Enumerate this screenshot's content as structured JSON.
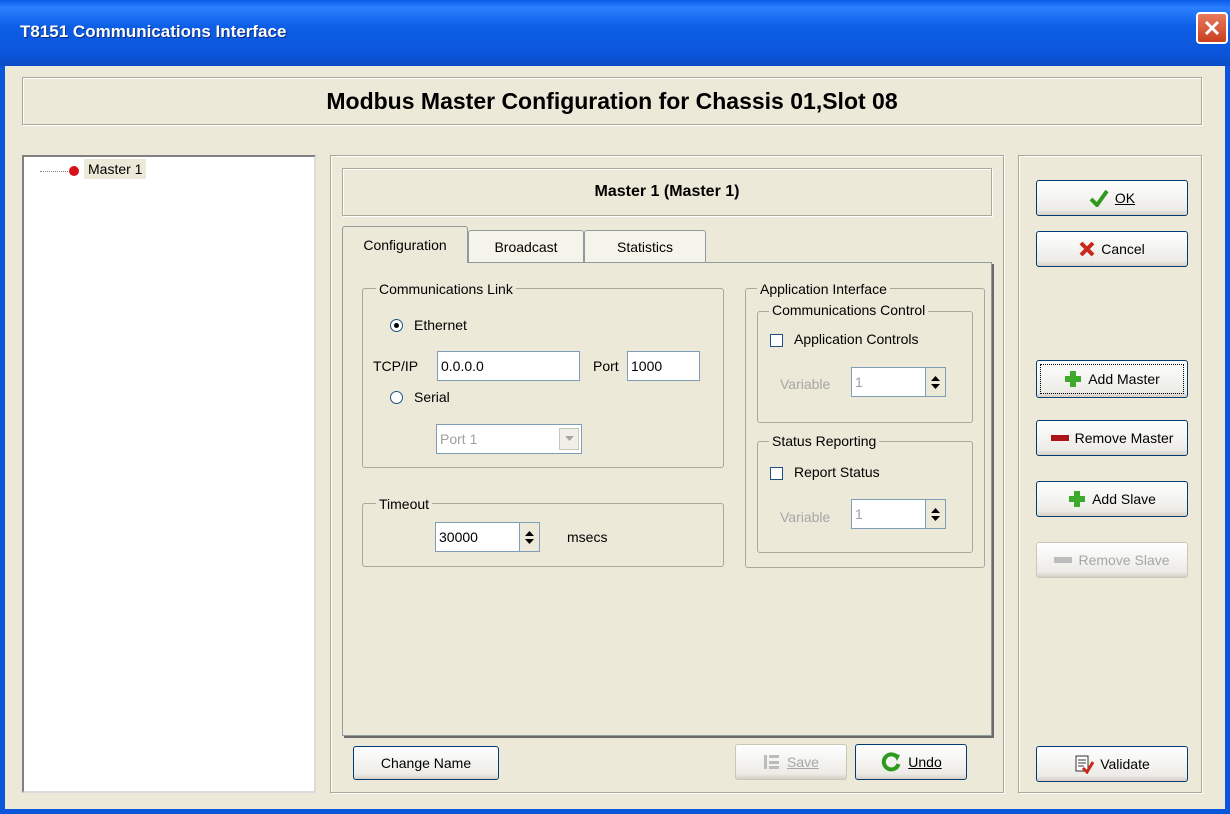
{
  "window": {
    "title": "T8151 Communications Interface"
  },
  "header": {
    "title": "Modbus Master Configuration for Chassis 01,Slot 08"
  },
  "tree": {
    "items": [
      {
        "label": "Master 1"
      }
    ]
  },
  "master_panel": {
    "title": "Master 1 (Master 1)"
  },
  "tabs": [
    {
      "label": "Configuration",
      "active": true
    },
    {
      "label": "Broadcast"
    },
    {
      "label": "Statistics"
    }
  ],
  "comms_link": {
    "title": "Communications Link",
    "ethernet_label": "Ethernet",
    "ethernet_selected": true,
    "tcpip_label": "TCP/IP",
    "tcpip_value": "0.0.0.0",
    "port_label": "Port",
    "port_value": "1000",
    "serial_label": "Serial",
    "serial_port_value": "Port 1"
  },
  "timeout": {
    "title": "Timeout",
    "value": "30000",
    "unit": "msecs"
  },
  "app_interface": {
    "title": "Application Interface",
    "comms_control": {
      "title": "Communications Control",
      "checkbox_label": "Application Controls",
      "variable_label": "Variable",
      "variable_value": "1"
    },
    "status_reporting": {
      "title": "Status Reporting",
      "checkbox_label": "Report Status",
      "variable_label": "Variable",
      "variable_value": "1"
    }
  },
  "bottom_buttons": {
    "change_name": "Change Name",
    "save": "Save",
    "undo": "Undo"
  },
  "right_buttons": {
    "ok": "OK",
    "cancel": "Cancel",
    "add_master": "Add Master",
    "remove_master": "Remove Master",
    "add_slave": "Add Slave",
    "remove_slave": "Remove Slave",
    "validate": "Validate"
  },
  "colors": {
    "titlebar": "#0b56db",
    "window_bg": "#ece9d8",
    "ok_check": "#2e9a1e",
    "cancel_x": "#c8281c",
    "plus_green": "#3caa2a",
    "minus_red": "#b0121a"
  }
}
